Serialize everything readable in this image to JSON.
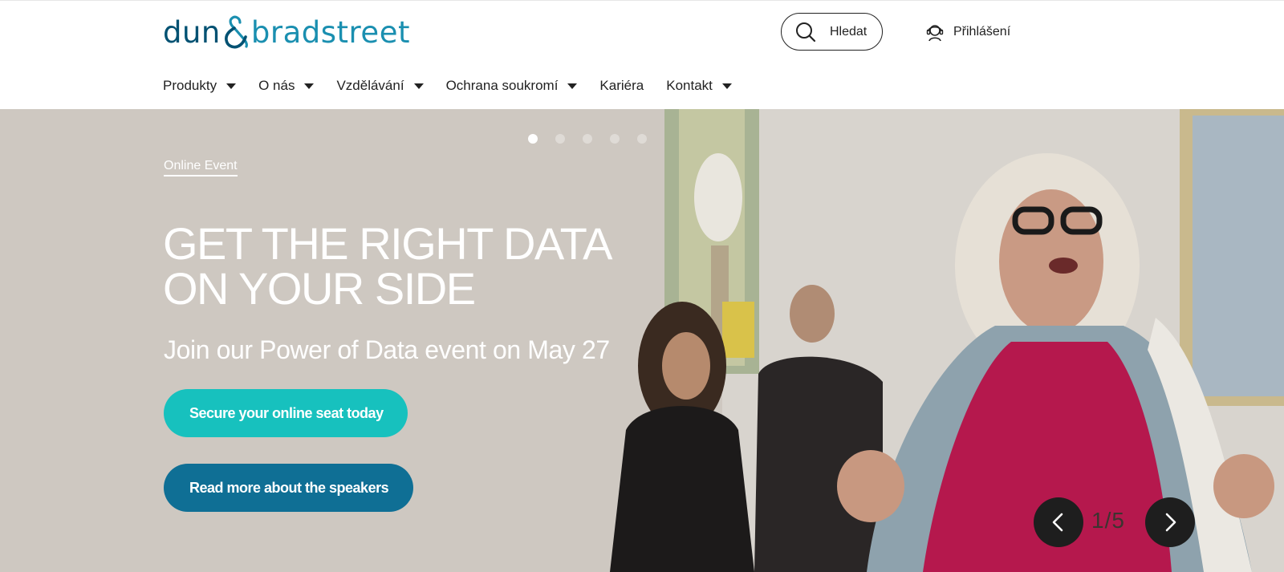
{
  "brand": {
    "word1": "dun",
    "word2": "bradstreet",
    "colors": {
      "primary": "#005172",
      "secondary": "#1a8fb0"
    }
  },
  "header": {
    "search_label": "Hledat",
    "login_label": "Přihlášení"
  },
  "nav": [
    {
      "label": "Produkty",
      "has_dropdown": true
    },
    {
      "label": "O nás",
      "has_dropdown": true
    },
    {
      "label": "Vzdělávání",
      "has_dropdown": true
    },
    {
      "label": "Ochrana soukromí",
      "has_dropdown": true
    },
    {
      "label": "Kariéra",
      "has_dropdown": false
    },
    {
      "label": "Kontakt",
      "has_dropdown": true
    }
  ],
  "hero": {
    "eyebrow": "Online Event",
    "headline": "GET THE RIGHT DATA ON YOUR SIDE",
    "subhead": "Join our Power of Data event on May 27",
    "cta_primary": "Secure your online seat today",
    "cta_secondary": "Read more about the speakers",
    "slide_counter": "1/5",
    "current_slide": 1,
    "total_slides": 5,
    "colors": {
      "cta_primary": "#17c1be",
      "cta_secondary": "#0f6f95"
    }
  }
}
